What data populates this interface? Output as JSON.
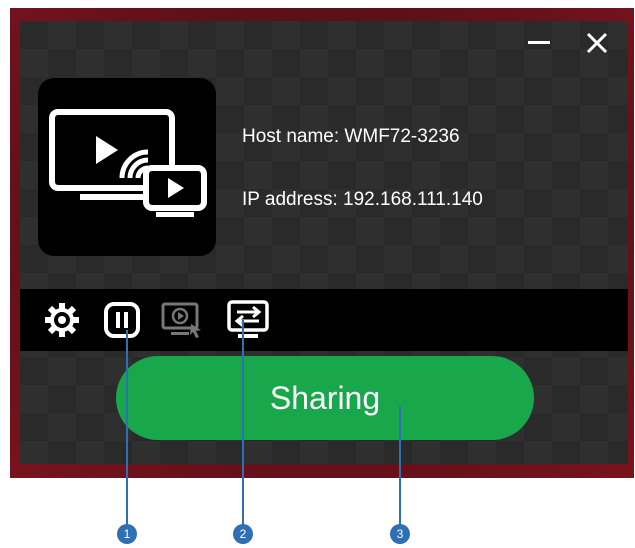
{
  "window": {
    "controls": {
      "minimize_icon": "minimize-icon",
      "close_icon": "close-icon"
    }
  },
  "device": {
    "host_label": "Host name: WMF72-3236",
    "ip_label": "IP address: 192.168.111.140",
    "logo_icon": "screen-cast-logo-icon"
  },
  "toolbar": {
    "items": [
      {
        "icon": "settings-gear-icon"
      },
      {
        "icon": "pause-icon"
      },
      {
        "icon": "screen-mirror-icon",
        "disabled": true
      },
      {
        "icon": "switch-arrows-icon"
      }
    ]
  },
  "main_action": {
    "label": "Sharing",
    "color": "#19a74b"
  },
  "callouts": [
    {
      "number": "1"
    },
    {
      "number": "2"
    },
    {
      "number": "3"
    }
  ],
  "colors": {
    "callout": "#2f6fb4",
    "frame": "#7a131d"
  }
}
